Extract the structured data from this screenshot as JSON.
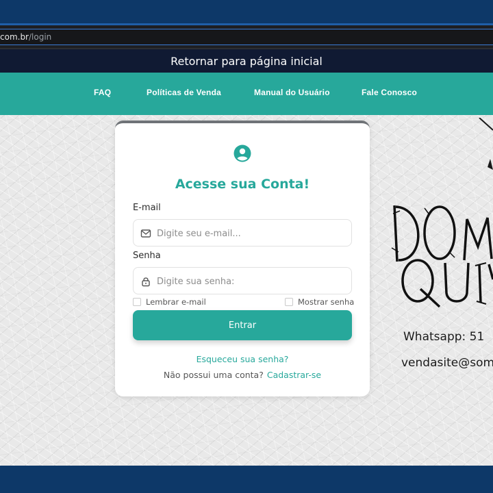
{
  "browser": {
    "url_host": "com.br",
    "url_path": "/login"
  },
  "return_bar": {
    "label": "Retornar para página inicial"
  },
  "nav": {
    "items": [
      {
        "label": "FAQ"
      },
      {
        "label": "Políticas de Venda"
      },
      {
        "label": "Manual do Usuário"
      },
      {
        "label": "Fale Conosco"
      }
    ]
  },
  "login": {
    "title": "Acesse sua Conta!",
    "email_label": "E-mail",
    "email_placeholder": "Digite seu e-mail...",
    "password_label": "Senha",
    "password_placeholder": "Digite sua senha:",
    "remember_label": "Lembrar e-mail",
    "show_password_label": "Mostrar senha",
    "submit_label": "Entrar",
    "forgot_label": "Esqueceu sua senha?",
    "no_account_text": "Não possui uma conta?",
    "signup_label": "Cadastrar-se"
  },
  "brand": {
    "logo_text": "DOM QUIX",
    "whatsapp_text": "Whatsapp: 51",
    "email_text": "vendasite@som"
  },
  "colors": {
    "accent": "#27a89b",
    "frame": "#0d3868",
    "return_bar": "#101a33"
  },
  "icons": {
    "user": "user-circle-icon",
    "email": "envelope-icon",
    "password": "lock-icon"
  }
}
